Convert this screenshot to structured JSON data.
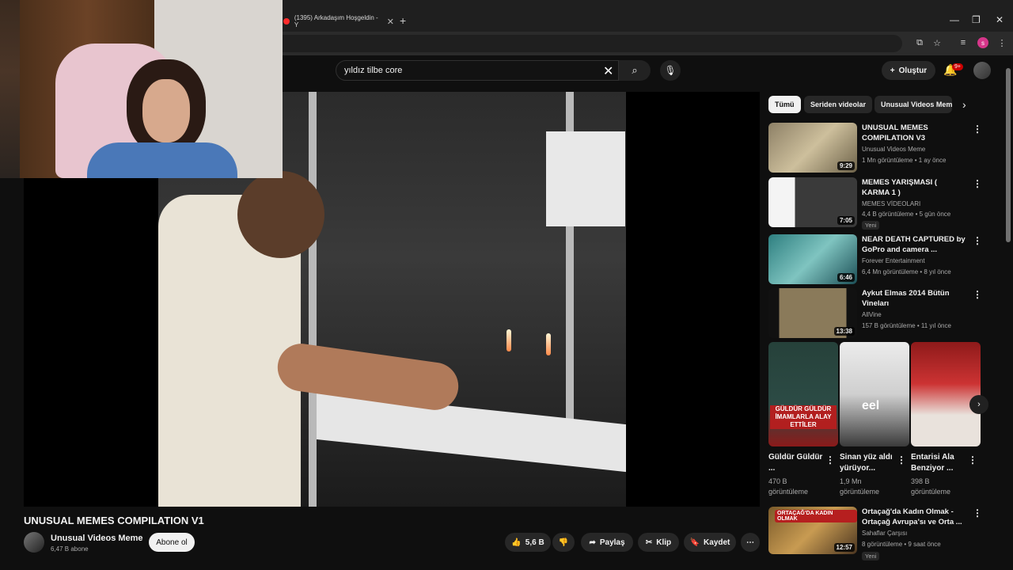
{
  "browser": {
    "tab_title": "(1395) Arkadaşım Hoşgeldin - Y",
    "close_tab": "✕",
    "new_tab": "+",
    "minimize": "—",
    "maximize": "❐",
    "close": "✕",
    "profile_initial": "s"
  },
  "header": {
    "search_value": "yıldız tilbe core",
    "create_label": "Oluştur",
    "notifications_badge": "9+"
  },
  "video": {
    "title": "UNUSUAL MEMES COMPILATION V1",
    "channel_name": "Unusual Videos Meme",
    "channel_subs": "6,47 B abone",
    "subscribe_label": "Abone ol",
    "likes": "5,6 B",
    "share_label": "Paylaş",
    "clip_label": "Klip",
    "save_label": "Kaydet"
  },
  "chips": [
    "Tümü",
    "Seriden videolar",
    "Unusual Videos Meme"
  ],
  "recommendations": [
    {
      "title": "UNUSUAL MEMES COMPILATION V3",
      "channel": "Unusual Videos Meme",
      "meta": "1 Mn görüntüleme • 1 ay önce",
      "duration": "9:29",
      "badge": ""
    },
    {
      "title": "MEMES YARIŞMASI ( KARMA 1 )",
      "channel": "MEMES VİDEOLARI",
      "meta": "4,4 B görüntüleme • 5 gün önce",
      "duration": "7:05",
      "badge": "Yeni"
    },
    {
      "title": "NEAR DEATH CAPTURED by GoPro and camera ...",
      "channel": "Forever Entertainment",
      "meta": "6,4 Mn görüntüleme • 8 yıl önce",
      "duration": "6:46",
      "badge": ""
    },
    {
      "title": "Aykut Elmas 2014 Bütün Vineları",
      "channel": "AllVine",
      "meta": "157 B görüntüleme • 11 yıl önce",
      "duration": "13:38",
      "badge": ""
    }
  ],
  "shorts": [
    {
      "title": "Güldür Güldür ...",
      "views": "470 B görüntüleme",
      "thumb_text": "GÜLDÜR GÜLDÜR İMAMLARLA ALAY ETTİLER"
    },
    {
      "title": "Sinan yüz aldı yürüyor...",
      "views": "1,9 Mn görüntüleme",
      "thumb_text": "eel"
    },
    {
      "title": "Entarisi Ala Benziyor ...",
      "views": "398 B görüntüleme",
      "thumb_text": ""
    }
  ],
  "last_recommendation": {
    "title": "Ortaçağ'da Kadın Olmak - Ortaçağ Avrupa'sı ve Orta ...",
    "channel": "Sahaflar Çarşısı",
    "meta": "8 görüntüleme • 9 saat önce",
    "duration": "12:57",
    "badge": "Yeni",
    "thumb_text": "ORTAÇAĞ'DA KADIN OLMAK"
  }
}
